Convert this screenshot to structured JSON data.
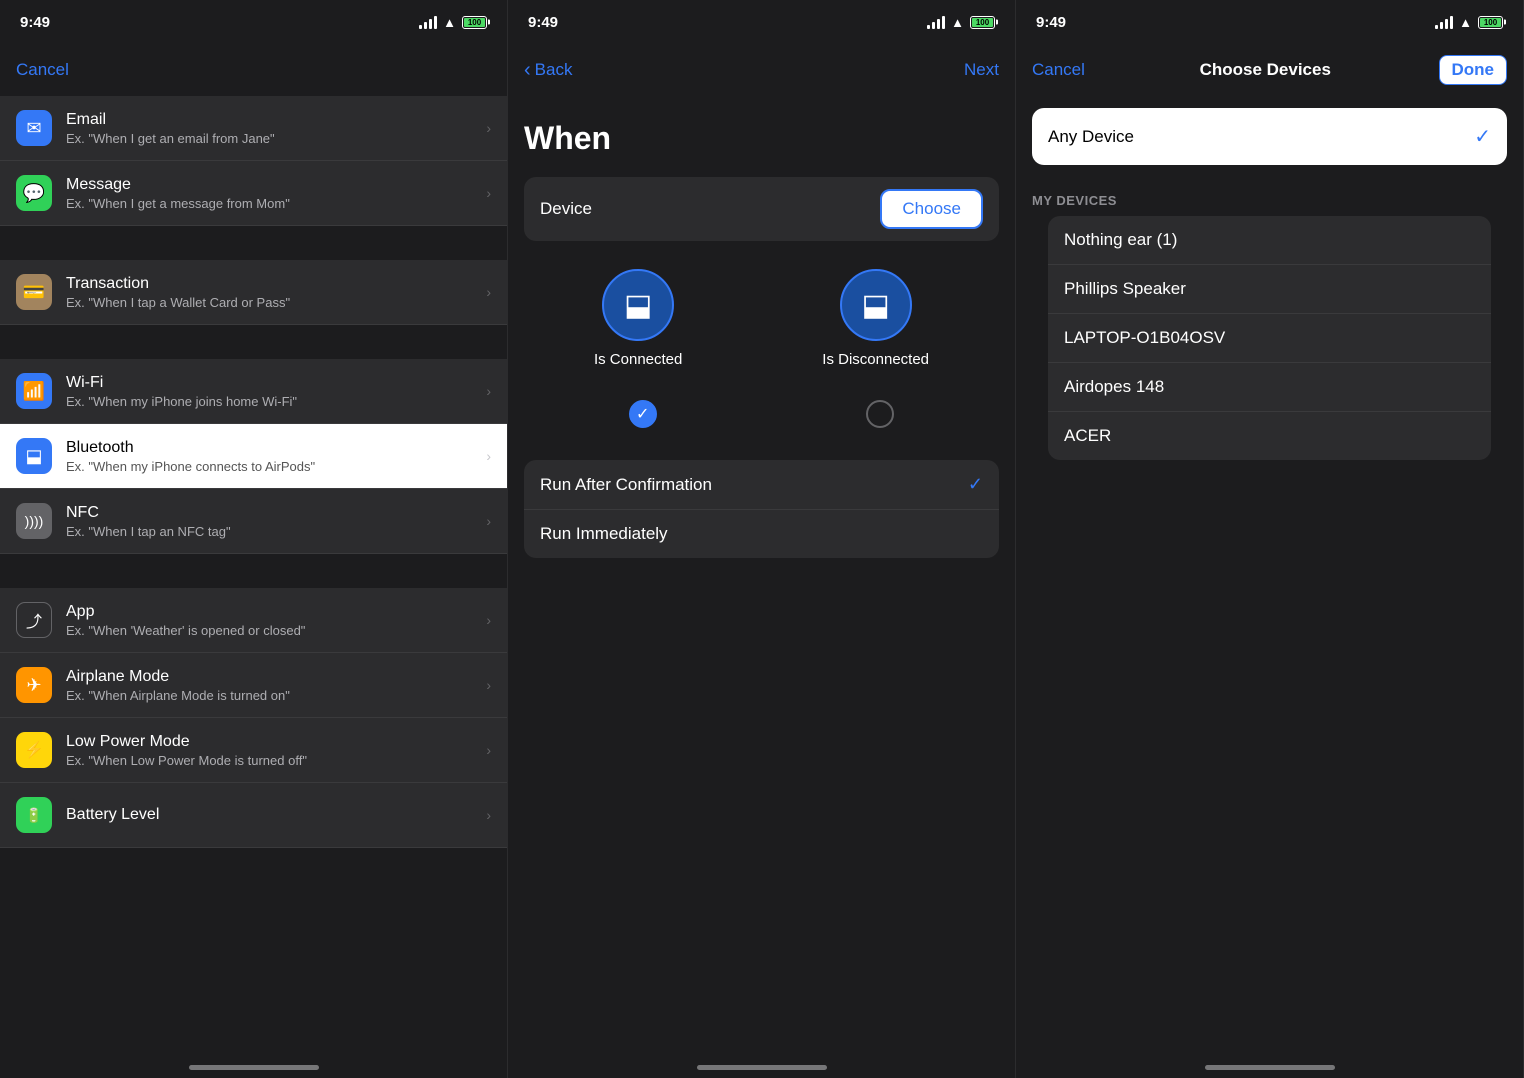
{
  "statusBar": {
    "time": "9:49",
    "battery": "100"
  },
  "panel1": {
    "nav": {
      "cancelLabel": "Cancel"
    },
    "items": [
      {
        "icon": "✉",
        "iconBg": "#3478f6",
        "title": "Email",
        "sub": "Ex. \"When I get an email from Jane\"",
        "highlighted": false
      },
      {
        "icon": "💬",
        "iconBg": "#30d158",
        "title": "Message",
        "sub": "Ex. \"When I get a message from Mom\"",
        "highlighted": false
      },
      {
        "icon": "≡",
        "iconBg": "#a2845e",
        "title": "Transaction",
        "sub": "Ex. \"When I tap a Wallet Card or Pass\"",
        "highlighted": false
      },
      {
        "icon": "wifi",
        "iconBg": "#3478f6",
        "title": "Wi-Fi",
        "sub": "Ex. \"When my iPhone joins home Wi-Fi\"",
        "highlighted": false
      },
      {
        "icon": "bt",
        "iconBg": "#3478f6",
        "title": "Bluetooth",
        "sub": "Ex. \"When my iPhone connects to AirPods\"",
        "highlighted": true
      },
      {
        "icon": "nfc",
        "iconBg": "#636366",
        "title": "NFC",
        "sub": "Ex. \"When I tap an NFC tag\"",
        "highlighted": false
      },
      {
        "icon": "app",
        "iconBg": "#1c1c1e",
        "title": "App",
        "sub": "Ex. \"When 'Weather' is opened or closed\"",
        "highlighted": false
      },
      {
        "icon": "✈",
        "iconBg": "#ff9500",
        "title": "Airplane Mode",
        "sub": "Ex. \"When Airplane Mode is turned on\"",
        "highlighted": false
      },
      {
        "icon": "⚡",
        "iconBg": "#ffd60a",
        "title": "Low Power Mode",
        "sub": "Ex. \"When Low Power Mode is turned off\"",
        "highlighted": false
      },
      {
        "icon": "▬",
        "iconBg": "#30d158",
        "title": "Battery Level",
        "sub": "",
        "highlighted": false
      }
    ]
  },
  "panel2": {
    "nav": {
      "backLabel": "Back",
      "nextLabel": "Next"
    },
    "pageTitle": "When",
    "deviceLabel": "Device",
    "chooseLabel": "Choose",
    "btOptions": [
      {
        "label": "Is Connected",
        "checked": true
      },
      {
        "label": "Is Disconnected",
        "checked": false
      }
    ],
    "runOptions": [
      {
        "label": "Run After Confirmation",
        "checked": true
      },
      {
        "label": "Run Immediately",
        "checked": false
      }
    ]
  },
  "panel3": {
    "nav": {
      "cancelLabel": "Cancel",
      "title": "Choose Devices",
      "doneLabel": "Done"
    },
    "anyDevice": {
      "label": "Any Device",
      "selected": true
    },
    "myDevicesHeader": "MY DEVICES",
    "devices": [
      "Nothing ear (1)",
      "Phillips Speaker",
      "LAPTOP-O1B04OSV",
      "Airdopes 148",
      "ACER"
    ]
  }
}
